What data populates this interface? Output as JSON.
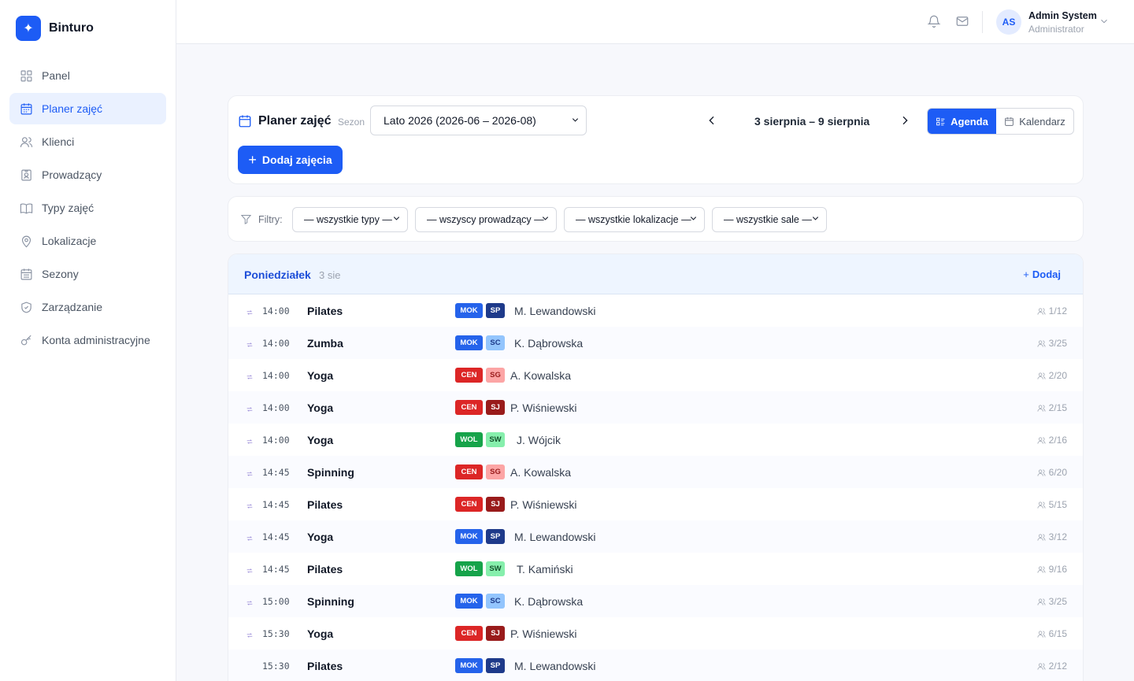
{
  "app": {
    "name": "Binturo"
  },
  "sidebar": {
    "items": [
      {
        "label": "Panel",
        "icon": "grid-icon",
        "active": false
      },
      {
        "label": "Planer zajęć",
        "icon": "calendar-icon",
        "active": true
      },
      {
        "label": "Klienci",
        "icon": "users-icon",
        "active": false
      },
      {
        "label": "Prowadzący",
        "icon": "id-badge-icon",
        "active": false
      },
      {
        "label": "Typy zajęć",
        "icon": "book-icon",
        "active": false
      },
      {
        "label": "Lokalizacje",
        "icon": "map-pin-icon",
        "active": false
      },
      {
        "label": "Sezony",
        "icon": "calendar-days-icon",
        "active": false
      },
      {
        "label": "Zarządzanie",
        "icon": "shield-icon",
        "active": false
      },
      {
        "label": "Konta administracyjne",
        "icon": "key-icon",
        "active": false
      }
    ]
  },
  "header": {
    "user": {
      "initials": "AS",
      "name": "Admin System",
      "role": "Administrator"
    }
  },
  "toolbar": {
    "title": "Planer zajęć",
    "season_label": "Sezon",
    "season_value": "Lato 2026 (2026-06 – 2026-08)",
    "week_label": "3 sierpnia – 9 sierpnia",
    "view_agenda": "Agenda",
    "view_calendar": "Kalendarz",
    "add_button": "Dodaj zajęcia"
  },
  "filters": {
    "label": "Filtry:",
    "type": "— wszystkie typy —",
    "instructor": "— wszyscy prowadzący —",
    "location": "— wszystkie lokalizacje —",
    "room": "— wszystkie sale —"
  },
  "agenda": {
    "day_name": "Poniedziałek",
    "day_date": "3 sie",
    "add_label": "Dodaj",
    "colors": {
      "MOK": "#2563eb",
      "CEN": "#dc2626",
      "WOL": "#16a34a",
      "SP": "#1e3a8a",
      "SC": "#93c5fd",
      "SG": "#fca5a5",
      "SJ": "#991b1b",
      "SW": "#86efac"
    },
    "rows": [
      {
        "time": "14:00",
        "name": "Pilates",
        "location": "MOK",
        "room": "SP",
        "instructor": "M. Lewandowski",
        "capacity": "1/12",
        "recurring": true
      },
      {
        "time": "14:00",
        "name": "Zumba",
        "location": "MOK",
        "room": "SC",
        "instructor": "K. Dąbrowska",
        "capacity": "3/25",
        "recurring": true
      },
      {
        "time": "14:00",
        "name": "Yoga",
        "location": "CEN",
        "room": "SG",
        "instructor": "A. Kowalska",
        "capacity": "2/20",
        "recurring": true
      },
      {
        "time": "14:00",
        "name": "Yoga",
        "location": "CEN",
        "room": "SJ",
        "instructor": "P. Wiśniewski",
        "capacity": "2/15",
        "recurring": true
      },
      {
        "time": "14:00",
        "name": "Yoga",
        "location": "WOL",
        "room": "SW",
        "instructor": "J. Wójcik",
        "capacity": "2/16",
        "recurring": true
      },
      {
        "time": "14:45",
        "name": "Spinning",
        "location": "CEN",
        "room": "SG",
        "instructor": "A. Kowalska",
        "capacity": "6/20",
        "recurring": true
      },
      {
        "time": "14:45",
        "name": "Pilates",
        "location": "CEN",
        "room": "SJ",
        "instructor": "P. Wiśniewski",
        "capacity": "5/15",
        "recurring": true
      },
      {
        "time": "14:45",
        "name": "Yoga",
        "location": "MOK",
        "room": "SP",
        "instructor": "M. Lewandowski",
        "capacity": "3/12",
        "recurring": true
      },
      {
        "time": "14:45",
        "name": "Pilates",
        "location": "WOL",
        "room": "SW",
        "instructor": "T. Kamiński",
        "capacity": "9/16",
        "recurring": true
      },
      {
        "time": "15:00",
        "name": "Spinning",
        "location": "MOK",
        "room": "SC",
        "instructor": "K. Dąbrowska",
        "capacity": "3/25",
        "recurring": true
      },
      {
        "time": "15:30",
        "name": "Yoga",
        "location": "CEN",
        "room": "SJ",
        "instructor": "P. Wiśniewski",
        "capacity": "6/15",
        "recurring": true
      },
      {
        "time": "15:30",
        "name": "Pilates",
        "location": "MOK",
        "room": "SP",
        "instructor": "M. Lewandowski",
        "capacity": "2/12",
        "recurring": false
      }
    ]
  }
}
